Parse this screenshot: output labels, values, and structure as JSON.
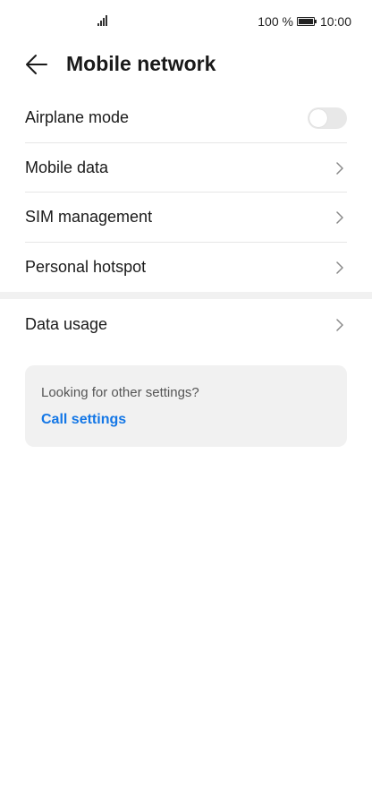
{
  "status_bar": {
    "battery_percent": "100 %",
    "time": "10:00",
    "signal_icon": "signal-icon",
    "battery_icon": "battery-icon"
  },
  "header": {
    "title": "Mobile network",
    "back_icon": "back-arrow-icon"
  },
  "list": {
    "airplane_mode": {
      "label": "Airplane mode",
      "toggle_on": false
    },
    "mobile_data": {
      "label": "Mobile data"
    },
    "sim_management": {
      "label": "SIM management"
    },
    "personal_hotspot": {
      "label": "Personal hotspot"
    },
    "data_usage": {
      "label": "Data usage"
    }
  },
  "card": {
    "prompt": "Looking for other settings?",
    "link": "Call settings"
  },
  "colors": {
    "link": "#1477e6",
    "card_bg": "#f1f1f1",
    "toggle_off": "#e8e8e8"
  }
}
